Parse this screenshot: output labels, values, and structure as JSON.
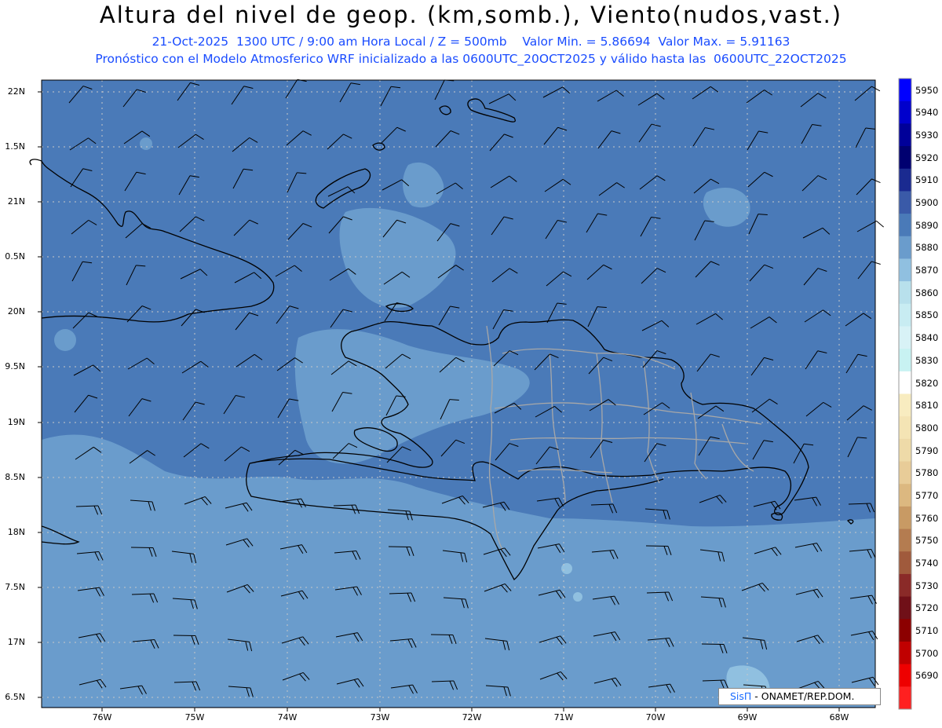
{
  "header": {
    "title": "Altura del nivel de geop. (km,somb.), Viento(nudos,vast.)",
    "subtitle_1": "21-Oct-2025  1300 UTC / 9:00 am Hora Local / Z = 500mb    Valor Min. = 5.86694  Valor Max. = 5.91163",
    "subtitle_2": "Pronóstico con el Modelo Atmosferico WRF inicializado a las 0600UTC_20OCT2025 y válido hasta las  0600UTC_22OCT2025"
  },
  "axes": {
    "lat_ticks": [
      "22N",
      "1.5N",
      "21N",
      "0.5N",
      "20N",
      "9.5N",
      "19N",
      "8.5N",
      "18N",
      "7.5N",
      "17N",
      "6.5N"
    ],
    "lon_ticks": [
      "76W",
      "75W",
      "74W",
      "73W",
      "72W",
      "71W",
      "70W",
      "69W",
      "68W"
    ]
  },
  "colorbar": {
    "levels": [
      5950,
      5940,
      5930,
      5920,
      5910,
      5900,
      5890,
      5880,
      5870,
      5860,
      5850,
      5840,
      5830,
      5820,
      5810,
      5800,
      5790,
      5780,
      5770,
      5760,
      5750,
      5740,
      5730,
      5720,
      5710,
      5700,
      5690
    ],
    "colors": [
      "#0000ff",
      "#0000cc",
      "#000099",
      "#000070",
      "#1a2a90",
      "#3a5aa8",
      "#4a7ab8",
      "#6a9ccc",
      "#90c0e0",
      "#b8e0ec",
      "#c8ecf2",
      "#d8f2f6",
      "#c8f2f2",
      "#ffffff",
      "#f8ecc0",
      "#f4e4b4",
      "#eedaa8",
      "#e8cc98",
      "#dcb880",
      "#c89a64",
      "#b47c50",
      "#a05a3c",
      "#8a2a28",
      "#701018",
      "#8c0000",
      "#c00000",
      "#ee0000",
      "#ff2020"
    ]
  },
  "credit": {
    "brand": "SisΠ",
    "rest": " -  ONAMET/REP.DOM."
  },
  "map_colors": {
    "background": "#4a7ab8",
    "light_fill": "#6a9ccc",
    "lighter_fill": "#90c0e0",
    "coast": "#000000",
    "provinces": "#a8a8a8",
    "grid": "#c8c8c8"
  }
}
